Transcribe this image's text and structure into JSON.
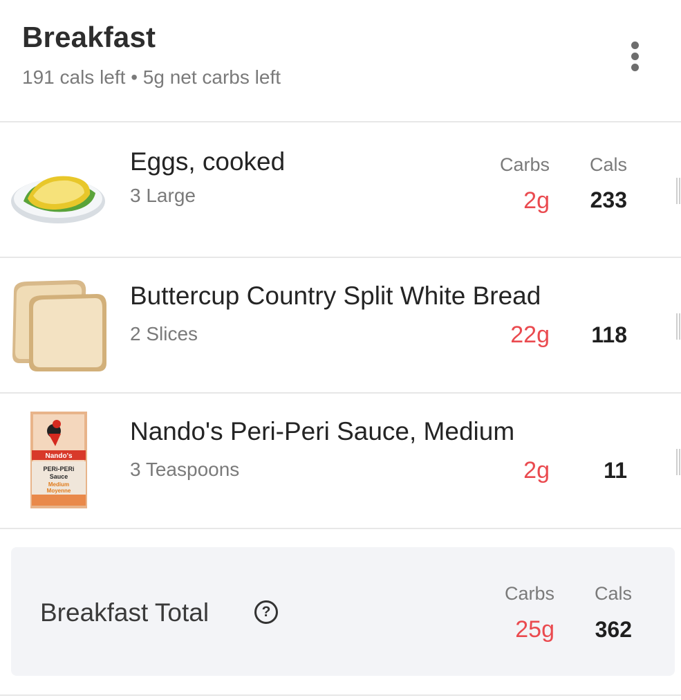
{
  "meal": {
    "title": "Breakfast",
    "summary": "191 cals left • 5g net carbs left",
    "more_icon": "more-vertical-icon"
  },
  "column_headers": {
    "carbs": "Carbs",
    "cals": "Cals"
  },
  "items": [
    {
      "name": "Eggs, cooked",
      "portion": "3 Large",
      "carbs": "2g",
      "cals": "233",
      "icon": "egg-plate-icon"
    },
    {
      "name": "Buttercup Country Split White Bread",
      "portion": "2 Slices",
      "carbs": "22g",
      "cals": "118",
      "icon": "bread-slices-icon"
    },
    {
      "name": "Nando's Peri-Peri Sauce, Medium",
      "portion": "3 Teaspoons",
      "carbs": "2g",
      "cals": "11",
      "icon": "sauce-bottle-icon",
      "label_text": {
        "brand": "Nando's",
        "line1": "PERi-PERi",
        "line2": "Sauce",
        "line3": "Medium",
        "line4": "Moyenne"
      }
    }
  ],
  "total": {
    "label": "Breakfast Total",
    "help_icon": "question-mark",
    "carbs_header": "Carbs",
    "cals_header": "Cals",
    "carbs": "25g",
    "cals": "362"
  },
  "colors": {
    "carbs": "#ea4a4f",
    "total_bg": "#f3f4f7",
    "divider": "#e7e7e7"
  }
}
